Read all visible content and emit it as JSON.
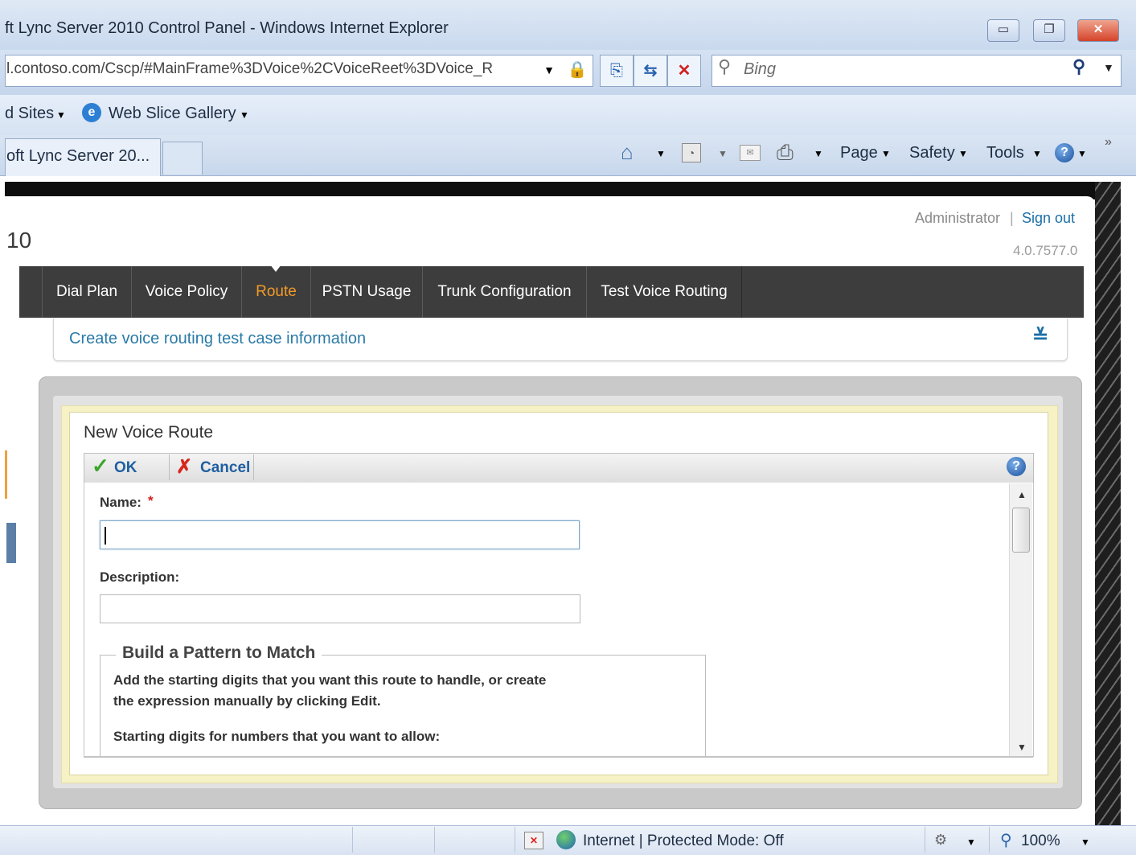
{
  "browser": {
    "title": "ft Lync Server 2010 Control Panel - Windows Internet Explorer",
    "window_buttons": {
      "minimize": "▭",
      "restore": "❐",
      "close": "✕"
    },
    "address": "l.contoso.com/Cscp/#MainFrame%3DVoice%2CVoiceReet%3DVoice_R",
    "search_placeholder": "Bing",
    "favorites": {
      "suggested_sites": "d Sites",
      "web_slice_gallery": "Web Slice Gallery"
    },
    "tab_title": "oft Lync Server 20...",
    "commands": {
      "page": "Page",
      "safety": "Safety",
      "tools": "Tools"
    },
    "chevron": "»"
  },
  "header": {
    "product_suffix": "10",
    "user": "Administrator",
    "separator": "|",
    "sign_out": "Sign out",
    "version": "4.0.7577.0"
  },
  "nav": {
    "tabs": [
      {
        "label": "Dial Plan"
      },
      {
        "label": "Voice Policy"
      },
      {
        "label": "Route",
        "active": true
      },
      {
        "label": "PSTN Usage"
      },
      {
        "label": "Trunk Configuration"
      },
      {
        "label": "Test Voice Routing"
      }
    ]
  },
  "info_bar": {
    "text": "Create voice routing test case information"
  },
  "dialog": {
    "title": "New Voice Route",
    "ok_label": "OK",
    "cancel_label": "Cancel",
    "name_label": "Name:",
    "required_marker": "*",
    "name_value": "",
    "description_label": "Description:",
    "description_value": "",
    "pattern_legend": "Build a Pattern to Match",
    "pattern_help_line1": "Add the starting digits that you want this route to handle, or create",
    "pattern_help_line2": "the expression manually by clicking Edit.",
    "starting_digits_label": "Starting digits for numbers that you want to allow:"
  },
  "status": {
    "zone": "Internet | Protected Mode: Off",
    "zoom": "100%"
  },
  "colors": {
    "nav_active": "#f39a28",
    "link": "#1a6fa8",
    "nav_bg": "#3d3d3d"
  }
}
